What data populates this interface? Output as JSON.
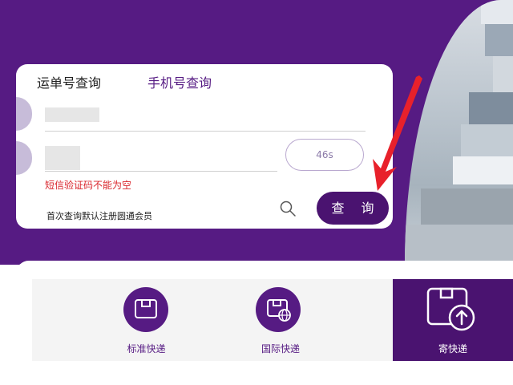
{
  "tabs": [
    {
      "label": "运单号查询",
      "active": true
    },
    {
      "label": "手机号查询",
      "active": false
    }
  ],
  "form": {
    "countdown": "46s",
    "error": "短信验证码不能为空",
    "note": "首次查询默认注册圆通会员",
    "query_label": "查 询"
  },
  "services": [
    {
      "label": "标准快递",
      "icon": "package-icon"
    },
    {
      "label": "国际快递",
      "icon": "international-package-icon"
    },
    {
      "label": "寄快递",
      "icon": "send-package-icon"
    }
  ],
  "colors": {
    "brand_purple": "#561b83",
    "dark_purple": "#4a1370",
    "error_red": "#d9262c",
    "arrow_red": "#e8212b"
  }
}
